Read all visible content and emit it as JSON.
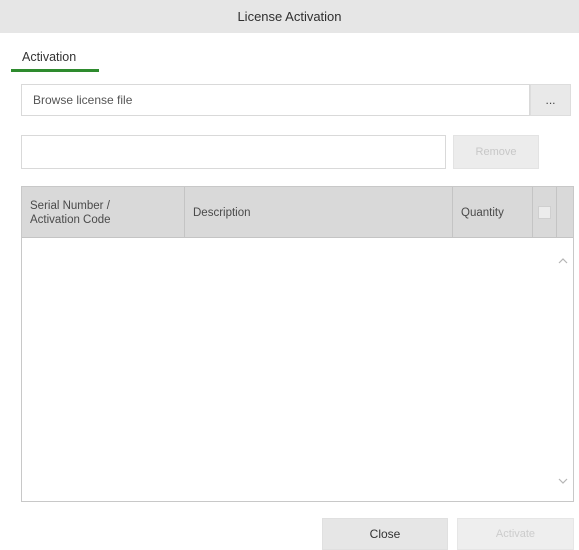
{
  "window": {
    "title": "License Activation"
  },
  "tabs": [
    {
      "label": "Activation",
      "active": true
    }
  ],
  "browse": {
    "placeholder": "Browse license file",
    "button_label": "..."
  },
  "serial": {
    "value": "",
    "remove_label": "Remove"
  },
  "table": {
    "columns": [
      {
        "label_line1": "Serial Number /",
        "label_line2": "Activation Code"
      },
      {
        "label": "Description"
      },
      {
        "label": "Quantity"
      }
    ],
    "rows": [],
    "select_all_checked": false
  },
  "footer": {
    "close_label": "Close",
    "activate_label": "Activate"
  },
  "colors": {
    "accent": "#2e8b2e",
    "titlebar": "#e6e6e6",
    "header": "#d9d9d9"
  },
  "icons": {
    "scroll_up": "chevron-up-icon",
    "scroll_down": "chevron-down-icon"
  }
}
